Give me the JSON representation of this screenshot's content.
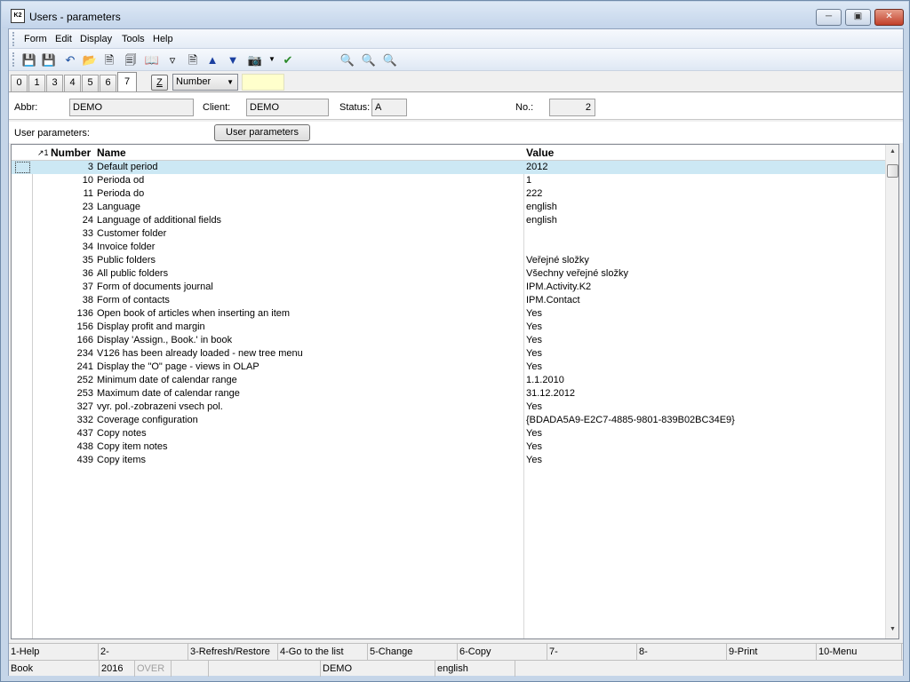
{
  "window": {
    "title": "Users - parameters",
    "app_icon_text": "K2"
  },
  "menu": [
    "Form",
    "Edit",
    "Display",
    "Tools",
    "Help"
  ],
  "tabs": [
    "0",
    "1",
    "3",
    "4",
    "5",
    "6",
    "7"
  ],
  "active_tab": "7",
  "tab_controls": {
    "z_label": "Z",
    "sort_combo": "Number"
  },
  "form": {
    "abbr_label": "Abbr:",
    "abbr_value": "DEMO",
    "client_label": "Client:",
    "client_value": "DEMO",
    "status_label": "Status:",
    "status_value": "A",
    "no_label": "No.:",
    "no_value": "2"
  },
  "user_params": {
    "label": "User parameters:",
    "button": "User parameters"
  },
  "grid": {
    "sort_marker": "↗1",
    "columns": [
      "Number",
      "Name",
      "Value"
    ],
    "rows": [
      {
        "number": "3",
        "name": "Default period",
        "value": "2012",
        "selected": true
      },
      {
        "number": "10",
        "name": "Perioda od",
        "value": "1"
      },
      {
        "number": "11",
        "name": "Perioda do",
        "value": "222"
      },
      {
        "number": "23",
        "name": "Language",
        "value": "english"
      },
      {
        "number": "24",
        "name": "Language of additional fields",
        "value": "english"
      },
      {
        "number": "33",
        "name": "Customer folder",
        "value": ""
      },
      {
        "number": "34",
        "name": "Invoice folder",
        "value": ""
      },
      {
        "number": "35",
        "name": "Public folders",
        "value": "Veřejné složky"
      },
      {
        "number": "36",
        "name": "All public folders",
        "value": "Všechny veřejné složky"
      },
      {
        "number": "37",
        "name": "Form of documents journal",
        "value": "IPM.Activity.K2"
      },
      {
        "number": "38",
        "name": "Form of contacts",
        "value": "IPM.Contact"
      },
      {
        "number": "136",
        "name": "Open book of articles when inserting an item",
        "value": "Yes"
      },
      {
        "number": "156",
        "name": "Display profit and margin",
        "value": "Yes"
      },
      {
        "number": "166",
        "name": "Display 'Assign., Book.' in book",
        "value": "Yes"
      },
      {
        "number": "234",
        "name": "V126 has been already loaded - new tree menu",
        "value": "Yes"
      },
      {
        "number": "241",
        "name": "Display the \"O\" page - views in OLAP",
        "value": "Yes"
      },
      {
        "number": "252",
        "name": "Minimum date of calendar range",
        "value": "1.1.2010"
      },
      {
        "number": "253",
        "name": "Maximum date of calendar range",
        "value": "31.12.2012"
      },
      {
        "number": "327",
        "name": "vyr. pol.-zobrazeni vsech pol.",
        "value": "Yes"
      },
      {
        "number": "332",
        "name": "Coverage configuration",
        "value": "{BDADA5A9-E2C7-4885-9801-839B02BC34E9}"
      },
      {
        "number": "437",
        "name": "Copy notes",
        "value": "Yes"
      },
      {
        "number": "438",
        "name": "Copy item notes",
        "value": "Yes"
      },
      {
        "number": "439",
        "name": "Copy items",
        "value": "Yes"
      }
    ]
  },
  "fkeys": [
    "1-Help",
    "2-",
    "3-Refresh/Restore",
    "4-Go to the list",
    "5-Change",
    "6-Copy",
    "7-",
    "8-",
    "9-Print",
    "10-Menu"
  ],
  "status": {
    "book": "Book",
    "year": "2016",
    "mode": "OVER",
    "blank1": "",
    "company": "DEMO",
    "language": "english"
  }
}
